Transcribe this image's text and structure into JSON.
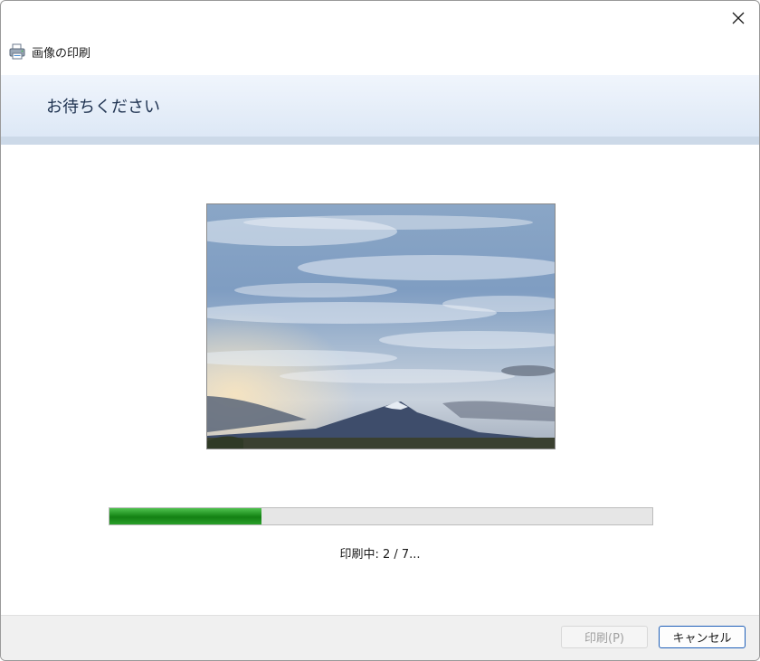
{
  "window": {
    "title": "画像の印刷",
    "close_icon": "close-icon",
    "app_icon": "printer-icon"
  },
  "header": {
    "title": "お待ちください"
  },
  "preview": {
    "description_icon": "image-preview"
  },
  "progress": {
    "fraction": 0.28,
    "status": "印刷中: 2 / 7..."
  },
  "buttons": {
    "print_label": "印刷(P)",
    "cancel_label": "キャンセル"
  },
  "colors": {
    "accent": "#1f5fb8",
    "progress": "#1c8c1c"
  }
}
